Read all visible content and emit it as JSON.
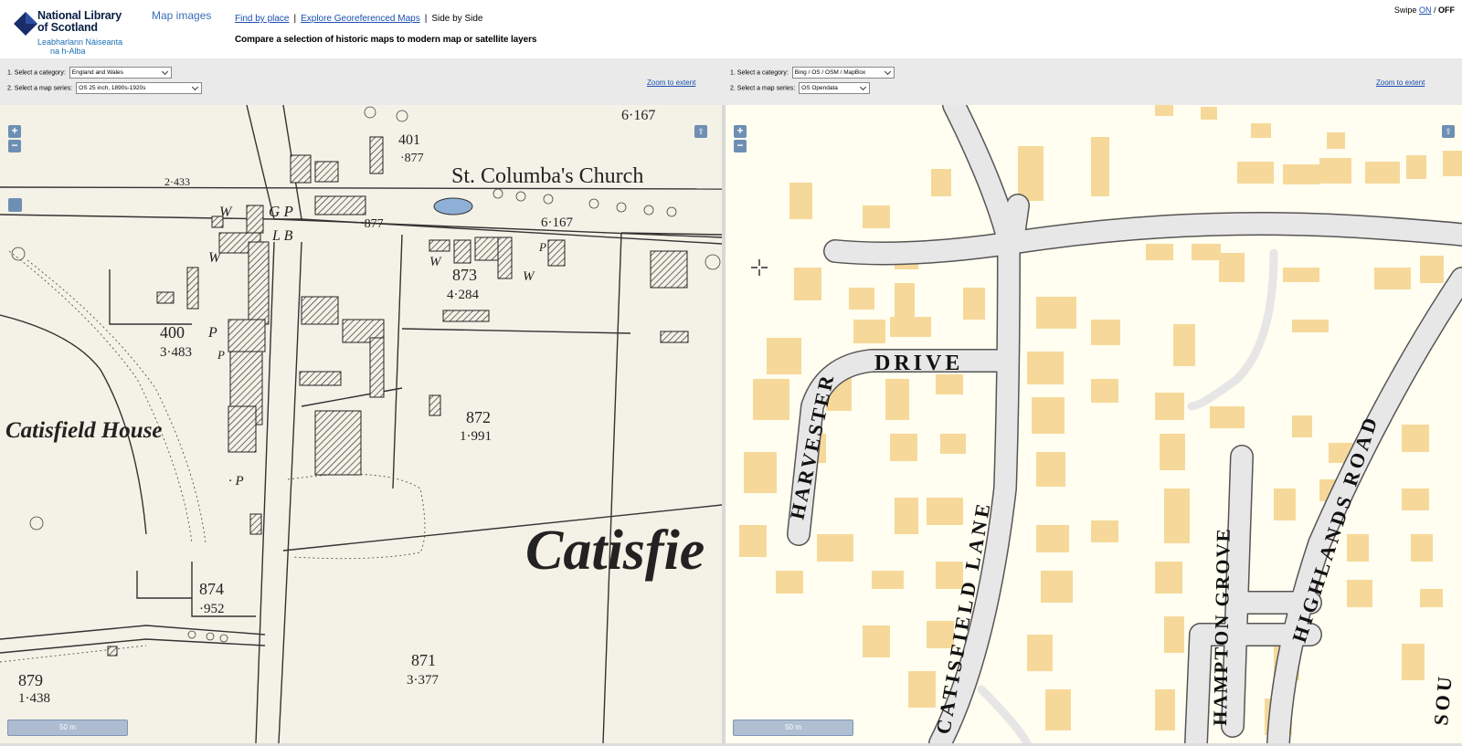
{
  "header": {
    "logo": {
      "line1": "National Library",
      "line2": "of Scotland",
      "line3": "Leabharlann Nàiseanta",
      "line4": "na h-Alba"
    },
    "app_title": "Map images",
    "nav": {
      "find_by_place": "Find by place",
      "sep1": "|",
      "explore": "Explore Georeferenced Maps",
      "sep2": "|",
      "current": "Side by Side"
    },
    "subtitle": "Compare a selection of historic maps to modern map or satellite layers",
    "swipe": {
      "label": "Swipe",
      "on": "ON",
      "slash": "/",
      "off": "OFF"
    }
  },
  "left_controls": {
    "category_label": "1. Select a category:",
    "category_value": "England and Wales",
    "series_label": "2. Select a map series:",
    "series_value": "OS 25 inch, 1890s-1920s",
    "zoom_extent": "Zoom to extent"
  },
  "right_controls": {
    "category_label": "1. Select a category:",
    "category_value": "Bing / OS / OSM / MapBox",
    "series_label": "2. Select a map series:",
    "series_value": "OS Opendata",
    "zoom_extent": "Zoom to extent"
  },
  "map_controls": {
    "zoom_in": "+",
    "zoom_out": "−",
    "fullscreen": "⇧"
  },
  "left_map": {
    "labels": {
      "church": "St. Columba's Church",
      "house": "Catisfield House",
      "village": "Catisfie",
      "p401": "401",
      "p401a": "·877",
      "p6167a": "6·167",
      "p6167b": "6·167",
      "p877": "·877",
      "p873": "873",
      "p873a": "4·284",
      "p400": "400",
      "p400a": "3·483",
      "p872": "872",
      "p872a": "1·991",
      "p874": "874",
      "p874a": "·952",
      "p871": "871",
      "p871a": "3·377",
      "p879": "879",
      "p879a": "1·438",
      "p2433": "2·433",
      "w1": "W",
      "w2": "W",
      "w3": "W",
      "w4": "W",
      "gp": "G P",
      "lb": "L B",
      "p1": "P",
      "p2": "P",
      "p3": "P",
      "p4": "· P"
    },
    "scale": "50 m"
  },
  "right_map": {
    "streets": {
      "harvester_drive_a": "HARVESTER",
      "harvester_drive_b": "DRIVE",
      "catisfield_lane": "CATISFIELD LANE",
      "hampton_grove": "HAMPTON GROVE",
      "highlands_road": "HIGHLANDS ROAD",
      "sou": "SOU"
    },
    "scale": "50 m"
  }
}
